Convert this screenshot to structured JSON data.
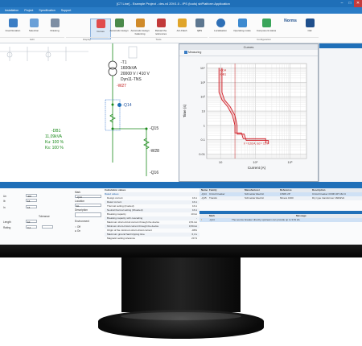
{
  "app": {
    "title": "[CT Line] - Example Project - des.v4 20V1.0 - IPS (tools) sbPlatform Application",
    "menu": [
      "Installation",
      "Project",
      "Specification",
      "Support"
    ],
    "ribbon_buttons": [
      "Insert/location",
      "Selection",
      "Drawing",
      "Curves",
      "Automatic design",
      "Automatic design balancing",
      "Reload the references",
      "Arc-Flash",
      "QBS",
      "Localisation",
      "Operating mode",
      "Component status",
      "Norms",
      "CEI"
    ],
    "ribbon_groups": [
      "Edit",
      "Display",
      "Tools",
      "Configuration"
    ],
    "norms_label": "Norms",
    "cei_label": "CEI"
  },
  "diagram": {
    "t1": {
      "name": "-T1",
      "power": "1600kVA",
      "voltage": "20000 V / 410 V",
      "coupling": "Dyn11-TNS"
    },
    "w27": "-W27",
    "q14": "-Q14",
    "q15": "-Q15",
    "w28": "-W28",
    "q16": "-Q16",
    "db1": {
      "name": "-DB1",
      "power": "11,09kVA",
      "ku": "Ku: 100 %",
      "ks": "Ks: 100 %"
    }
  },
  "curve": {
    "window_title": "Curves",
    "toolbar_label": "Measuring",
    "ylabel": "Time (s)",
    "xlabel": "Current (A)",
    "annotation_top": "-Q14",
    "annotation_mid": "-DB1",
    "annotation_bottom": "Ir = 6,63 A, Isd = 15 Ir"
  },
  "chart_data": {
    "type": "line",
    "xscale": "log",
    "yscale": "log",
    "xlabel": "Current (A)",
    "ylabel": "Time (s)",
    "xticks": [
      "10",
      "10²",
      "10³"
    ],
    "yticks": [
      "10⁴",
      "10³",
      "10²",
      "10",
      "1",
      "0.1",
      "0.01"
    ],
    "xlim": [
      4,
      3000
    ],
    "ylim": [
      0.005,
      20000
    ],
    "series": [
      {
        "name": "-Q14",
        "color": "#d0202a",
        "points": [
          [
            9,
            10000
          ],
          [
            9,
            200
          ],
          [
            11,
            60
          ],
          [
            16,
            20
          ],
          [
            22,
            5
          ],
          [
            26,
            1
          ],
          [
            26,
            0.3
          ],
          [
            40,
            0.3
          ],
          [
            45,
            0.12
          ],
          [
            200,
            0.12
          ],
          [
            200,
            0.06
          ]
        ]
      },
      {
        "name": "-DB1",
        "color": "#d0202a",
        "points": [
          [
            11,
            10000
          ],
          [
            11,
            200
          ],
          [
            13,
            60
          ],
          [
            19,
            20
          ],
          [
            26,
            5
          ],
          [
            30,
            1
          ],
          [
            30,
            0.25
          ],
          [
            48,
            0.25
          ],
          [
            55,
            0.09
          ],
          [
            240,
            0.09
          ],
          [
            240,
            0.05
          ]
        ]
      }
    ]
  },
  "properties": {
    "fields": [
      {
        "label": "Un",
        "value": "400"
      },
      {
        "label": "Ib",
        "value": "16"
      },
      {
        "label": "In",
        "value": "16"
      },
      {
        "label": "Tolerance",
        "value": ""
      },
      {
        "label": "Length",
        "value": "10"
      },
      {
        "label": "Rating",
        "value": "0,2"
      }
    ],
    "name_label": "Mark",
    "name_value": "-Q14",
    "location_label": "Location",
    "location_value": "EL",
    "description_label": "Description",
    "environment_label": "Environment",
    "radio_options": [
      "Off",
      "On"
    ]
  },
  "calc": {
    "header": "Calculation values",
    "subheader": "Rated values",
    "rows": [
      [
        "Design current",
        "16 A"
      ],
      [
        "Rated current",
        "16 A"
      ],
      [
        "Thermal setting (Irsetted)",
        "16 A"
      ],
      [
        "Neutral thermal setting (Ithsetted)",
        "16 A"
      ],
      [
        "Breaking capacity",
        "10 kA"
      ],
      [
        "Breaking capacity with cascading",
        "-"
      ],
      [
        "Maximum short-circuit current through the device",
        "3,51 kA"
      ],
      [
        "Minimum short-circuit current through the device",
        "0,59 kA"
      ],
      [
        "Origin of the minimum short-circuit current",
        "-DB1"
      ],
      [
        "Maximum ground fault tripping time",
        "0,4 s"
      ],
      [
        "Magnetic setting tolerance",
        "20 %"
      ]
    ]
  },
  "components": {
    "columns": [
      "Name",
      "Family",
      "Manufacturer",
      "Reference",
      "Description"
    ],
    "rows": [
      [
        "-Q14",
        "Circuit breaker",
        "Schneider Electric",
        "iC60N 2P",
        "Circuit breaker iC60N 2P 16A C"
      ],
      [
        "-Q15",
        "Transfo",
        "Schneider Electric",
        "Minera 1600",
        "Dry type transformer 1600kVA"
      ]
    ]
  },
  "messages": {
    "columns": [
      "",
      "Mark",
      "Message"
    ],
    "rows": [
      [
        "!",
        "-Q14",
        "The source breaker directly upstream can provide up to 3,51 kA."
      ]
    ]
  }
}
